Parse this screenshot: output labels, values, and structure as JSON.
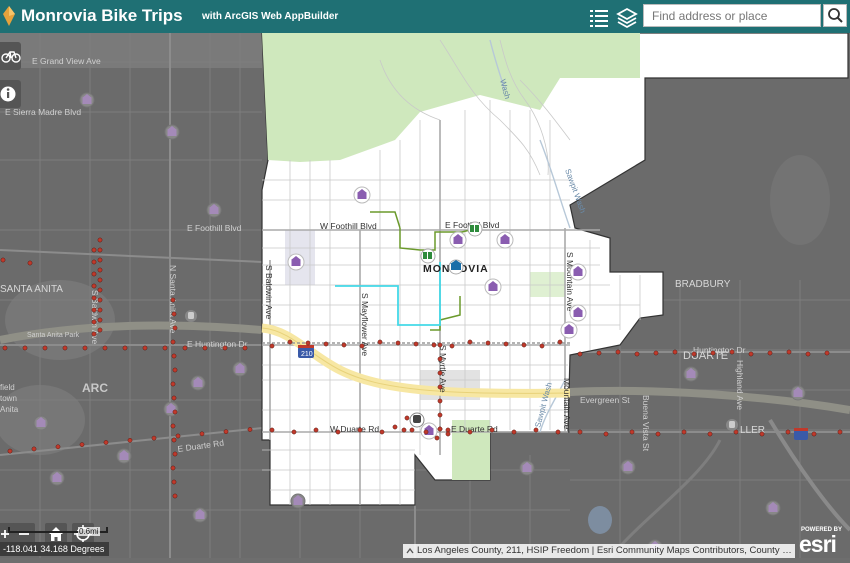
{
  "header": {
    "title": "Monrovia Bike Trips",
    "subtitle": "with ArcGIS Web AppBuilder",
    "layer_list_icon": "layer-list-icon",
    "basemap_icon": "layers-icon",
    "search": {
      "placeholder": "Find address or place",
      "value": "",
      "button_icon": "search-icon"
    }
  },
  "map": {
    "city_label": "MONROVIA",
    "street_labels": {
      "grand_view": "E Grand View Ave",
      "sierra_madre": "E Sierra Madre Blvd",
      "foothill_west": "E Foothill Blvd",
      "w_foothill": "W Foothill Blvd",
      "e_foothill": "E Foothill Blvd",
      "huntington_west": "E Huntington Dr",
      "huntington_east": "Huntington Dr",
      "duarte_rd_west": "E Duarte Rd",
      "w_duarte": "W Duarte Rd",
      "e_duarte": "E Duarte Rd",
      "evergreen": "Evergreen St",
      "mayflower": "S Mayflower Ave",
      "myrtle": "S Myrtle Ave",
      "mountain_north": "S Mountain Ave",
      "mountain_south": "Mountain Ave",
      "santa_anita": "N Santa Anita Ave",
      "baldwin": "S Baldwin Ave",
      "sawpit_north": "Sawpit Wash",
      "sawpit_south": "Sawpit Wash",
      "wash_north": "Wash",
      "highland": "Highland Ave",
      "buena_vista": "Buena Vista St",
      "santa_anita_area": "SANTA ANITA",
      "arcadia": "ARC",
      "santa_anita_park": "Santa Anita Park",
      "field": "field",
      "town": "town",
      "anita": "Anita",
      "bradbury": "BRADBURY",
      "duarte": "DUARTE",
      "caller": "LLER",
      "hwy_210": "210"
    },
    "scale_label": "0.6mi",
    "coordinates": "-118.041 34.168 Degrees",
    "attribution": "Los Angeles County, 211, HSIP Freedom | Esri Community Maps Contributors, County of Los Angeles, California State Parks, Esri, HERE, Garmin, SafeGraph, FAO, METI/NASA, USGS, Bureau of Land Management, EPA, NPS",
    "esri_powered": "POWERED BY",
    "esri_logo": "esri"
  },
  "widgets": {
    "bike_icon": "bicycle-icon",
    "info_icon": "info-icon",
    "zoom_in": "+",
    "zoom_out": "−",
    "home_icon": "home-icon",
    "locate_icon": "locate-icon"
  },
  "colors": {
    "header": "#1f7074",
    "poi": "#8a5db0",
    "bike_points": "#c0392b",
    "route_green": "#6b9a2c",
    "route_cyan": "#44d9e8",
    "park": "#cde8b8",
    "freeway": "#f6e6a0"
  }
}
